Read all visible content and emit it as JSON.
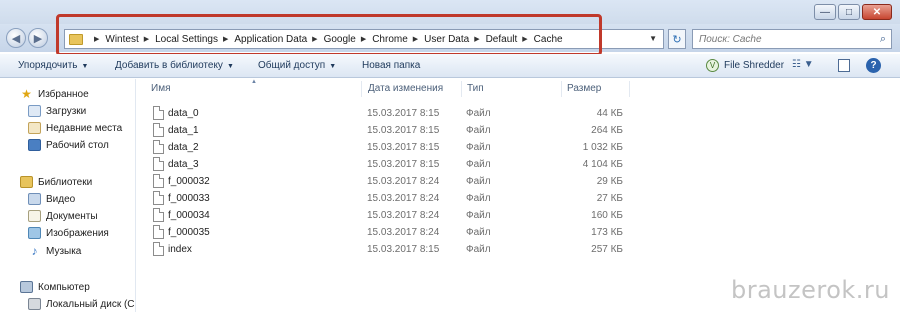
{
  "window": {
    "controls": {
      "minimize": "—",
      "maximize": "□",
      "close": "✕"
    }
  },
  "navigation": {
    "back_icon": "◀",
    "forward_icon": "▶"
  },
  "address_bar": {
    "breadcrumbs": [
      "Wintest",
      "Local Settings",
      "Application Data",
      "Google",
      "Chrome",
      "User Data",
      "Default",
      "Cache"
    ],
    "dropdown_icon": "▼",
    "refresh_icon": "↻"
  },
  "search": {
    "placeholder": "Поиск: Cache",
    "icon": "search-icon"
  },
  "toolbar": {
    "organize": "Упорядочить",
    "add_to_library": "Добавить в библиотеку",
    "share": "Общий доступ",
    "new_folder": "Новая папка",
    "file_shredder": "File Shredder",
    "help": "?"
  },
  "sidebar": {
    "favorites": {
      "label": "Избранное",
      "items": [
        "Загрузки",
        "Недавние места",
        "Рабочий стол"
      ]
    },
    "libraries": {
      "label": "Библиотеки",
      "items": [
        "Видео",
        "Документы",
        "Изображения",
        "Музыка"
      ]
    },
    "computer": {
      "label": "Компьютер",
      "items": [
        "Локальный диск (C"
      ]
    }
  },
  "columns": {
    "name": "Имя",
    "date": "Дата изменения",
    "type": "Тип",
    "size": "Размер"
  },
  "files": [
    {
      "name": "data_0",
      "date": "15.03.2017 8:15",
      "type": "Файл",
      "size": "44 КБ"
    },
    {
      "name": "data_1",
      "date": "15.03.2017 8:15",
      "type": "Файл",
      "size": "264 КБ"
    },
    {
      "name": "data_2",
      "date": "15.03.2017 8:15",
      "type": "Файл",
      "size": "1 032 КБ"
    },
    {
      "name": "data_3",
      "date": "15.03.2017 8:15",
      "type": "Файл",
      "size": "4 104 КБ"
    },
    {
      "name": "f_000032",
      "date": "15.03.2017 8:24",
      "type": "Файл",
      "size": "29 КБ"
    },
    {
      "name": "f_000033",
      "date": "15.03.2017 8:24",
      "type": "Файл",
      "size": "27 КБ"
    },
    {
      "name": "f_000034",
      "date": "15.03.2017 8:24",
      "type": "Файл",
      "size": "160 КБ"
    },
    {
      "name": "f_000035",
      "date": "15.03.2017 8:24",
      "type": "Файл",
      "size": "173 КБ"
    },
    {
      "name": "index",
      "date": "15.03.2017 8:15",
      "type": "Файл",
      "size": "257 КБ"
    }
  ],
  "watermark": "brauzerok.ru",
  "colors": {
    "highlight": "#c0392b",
    "toolbar_text": "#1e395b"
  }
}
